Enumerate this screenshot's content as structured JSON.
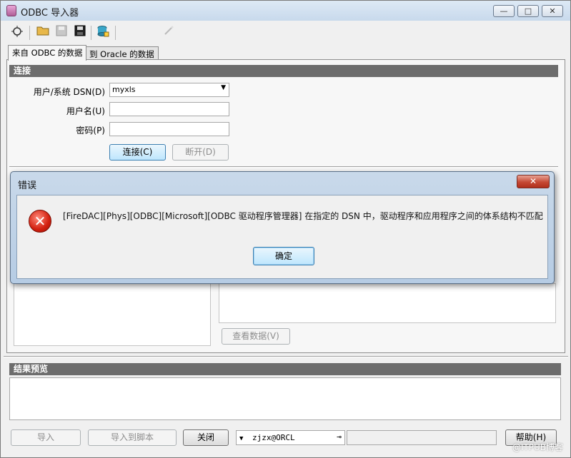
{
  "window": {
    "title": "ODBC 导入器",
    "min_label": "—",
    "max_label": "□",
    "close_label": "✕"
  },
  "toolbar": {
    "icons": [
      "new-icon",
      "open-folder-icon",
      "save-icon",
      "save-as-icon",
      "database-icon",
      "wand-icon"
    ]
  },
  "tabs": [
    {
      "label": "来自 ODBC 的数据",
      "active": true
    },
    {
      "label": "到 Oracle 的数据",
      "active": false
    }
  ],
  "connect": {
    "header": "连接",
    "dsn_label": "用户/系统 DSN(D)",
    "dsn_value": "myxls",
    "user_label": "用户名(U)",
    "user_value": "",
    "password_label": "密码(P)",
    "password_value": "",
    "connect_button": "连接(C)",
    "disconnect_button": "断开(D)"
  },
  "view_data_button": "查看数据(V)",
  "result_preview": {
    "header": "结果预览"
  },
  "footer": {
    "import_button": "导入",
    "import_script_button": "导入到脚本",
    "close_button": "关闭",
    "connection_value": "zjzx@ORCL",
    "help_button": "帮助(H)"
  },
  "dialog": {
    "title": "错误",
    "close_label": "✕",
    "message": "[FireDAC][Phys][ODBC][Microsoft][ODBC 驱动程序管理器] 在指定的 DSN 中，驱动程序和应用程序之间的体系结构不匹配",
    "ok_button": "确定"
  },
  "watermark": "@ITPUB博客",
  "colors": {
    "section_header": "#6d6d6d",
    "error_red": "#d21f0f",
    "focus_blue": "#3c7fb1"
  }
}
